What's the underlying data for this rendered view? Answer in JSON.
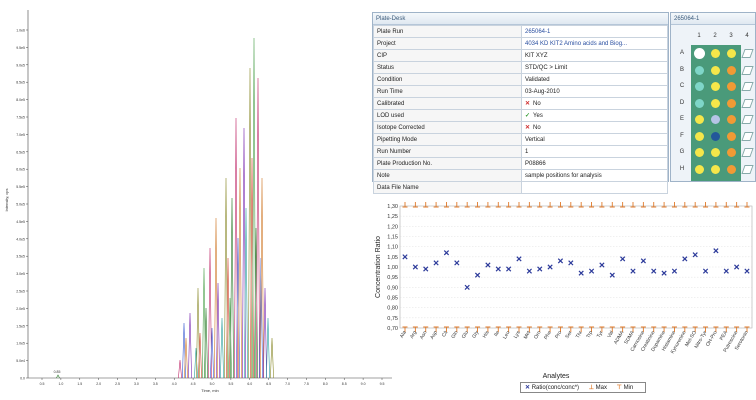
{
  "chromatogram": {
    "xlabel": "Time, min",
    "ylabel": "Intensity, cps",
    "yticks": [
      "1.0e6",
      "9.5e5",
      "9.0e5",
      "8.5e5",
      "8.0e5",
      "7.5e5",
      "7.0e5",
      "6.5e5",
      "6.0e5",
      "5.5e5",
      "5.0e5",
      "4.5e5",
      "4.0e5",
      "3.5e5",
      "3.0e5",
      "2.5e5",
      "2.0e5",
      "1.5e5",
      "1.0e5",
      "5.0e4",
      "0.0"
    ],
    "xticks": [
      "0.5",
      "1.0",
      "1.5",
      "2.0",
      "2.5",
      "3.0",
      "3.5",
      "4.0",
      "4.5",
      "5.0",
      "5.5",
      "6.0",
      "6.5",
      "7.0",
      "7.5",
      "8.0",
      "8.5",
      "9.0",
      "9.5"
    ],
    "peak_label": "0.85"
  },
  "plate_desk": {
    "title": "Plate-Desk",
    "rows": [
      {
        "key": "Plate Run",
        "value": "265064-1",
        "link": true
      },
      {
        "key": "Project",
        "value": "4034 KD KIT2 Amino acids and Biog...",
        "link": true
      },
      {
        "key": "CIP",
        "value": "KIT XYZ"
      },
      {
        "key": "Status",
        "value": "STD/QC > Limit"
      },
      {
        "key": "Condition",
        "value": "Validated"
      },
      {
        "key": "Run Time",
        "value": "03-Aug-2010"
      },
      {
        "key": "Calibrated",
        "value": "No",
        "mark": "x"
      },
      {
        "key": "LOD used",
        "value": "Yes",
        "mark": "ok"
      },
      {
        "key": "Isotope Corrected",
        "value": "No",
        "mark": "x"
      },
      {
        "key": "Pipetting Mode",
        "value": "Vertical"
      },
      {
        "key": "Run Number",
        "value": "1"
      },
      {
        "key": "Plate Production No.",
        "value": "P08866"
      },
      {
        "key": "Note",
        "value": "sample positions for analysis"
      },
      {
        "key": "Data File Name",
        "value": ""
      }
    ]
  },
  "plate_map": {
    "title": "265064-1",
    "columns": [
      "1",
      "2",
      "3",
      "4"
    ],
    "rows": [
      "A",
      "B",
      "C",
      "D",
      "E",
      "F",
      "G",
      "H"
    ],
    "wells": [
      [
        "#ffffff",
        "#f5e64a",
        "#f5e64a"
      ],
      [
        "#7fd6c8",
        "#f5e64a",
        "#f09a35"
      ],
      [
        "#7fd6c8",
        "#f5e64a",
        "#f09a35"
      ],
      [
        "#7fd6c8",
        "#f5e64a",
        "#f09a35"
      ],
      [
        "#f5e64a",
        "#b6c4e6",
        "#f09a35"
      ],
      [
        "#f5e64a",
        "#23579a",
        "#f09a35"
      ],
      [
        "#f5e64a",
        "#f5e64a",
        "#f09a35"
      ],
      [
        "#f5e64a",
        "#f5e64a",
        "#f09a35"
      ]
    ]
  },
  "chart_data": {
    "type": "scatter",
    "ylabel": "Concentration Ratio",
    "xlabel": "Analytes",
    "ylim": [
      0.7,
      1.3
    ],
    "yticks": [
      "1,30",
      "1,25",
      "1,20",
      "1,15",
      "1,10",
      "1,05",
      "1,00",
      "0,95",
      "0,90",
      "0,85",
      "0,80",
      "0,75",
      "0,70"
    ],
    "categories": [
      "Ala",
      "Arg",
      "Asn",
      "Asp",
      "Cit",
      "Gln",
      "Glu",
      "Gly",
      "His",
      "Ile",
      "Leu",
      "Lys",
      "Met",
      "Orn",
      "Phe",
      "Pro",
      "Ser",
      "Thr",
      "Trp",
      "Tyr",
      "Val",
      "ADMA",
      "SDMA",
      "Carnosine",
      "Creatinine",
      "Dopamine",
      "Histamine",
      "Kynurenine",
      "Met-SO",
      "Nitro-Tyr",
      "OH-Pro",
      "PEA",
      "Putrescine",
      "Serotonin"
    ],
    "series": [
      {
        "name": "Ratio(conc/conc*)",
        "values": [
          1.05,
          1.0,
          0.99,
          1.02,
          1.07,
          1.02,
          0.9,
          0.96,
          1.01,
          0.99,
          0.99,
          1.04,
          0.98,
          0.99,
          1.0,
          1.03,
          1.02,
          0.97,
          0.98,
          1.01,
          0.96,
          1.04,
          0.98,
          1.03,
          0.98,
          0.97,
          0.98,
          1.04,
          1.06,
          0.98,
          1.08,
          0.98,
          1.0,
          0.98
        ]
      },
      {
        "name": "Max",
        "values": [
          1.3,
          1.3,
          1.3,
          1.3,
          1.3,
          1.3,
          1.3,
          1.3,
          1.3,
          1.3,
          1.3,
          1.3,
          1.3,
          1.3,
          1.3,
          1.3,
          1.3,
          1.3,
          1.3,
          1.3,
          1.3,
          1.3,
          1.3,
          1.3,
          1.3,
          1.3,
          1.3,
          1.3,
          1.3,
          1.3,
          1.3,
          1.3,
          1.3,
          1.3
        ]
      },
      {
        "name": "Min",
        "values": [
          0.7,
          0.7,
          0.7,
          0.7,
          0.7,
          0.7,
          0.7,
          0.7,
          0.7,
          0.7,
          0.7,
          0.7,
          0.7,
          0.7,
          0.7,
          0.7,
          0.7,
          0.7,
          0.7,
          0.7,
          0.7,
          0.7,
          0.7,
          0.7,
          0.7,
          0.7,
          0.7,
          0.7,
          0.7,
          0.7,
          0.7,
          0.7,
          0.7,
          0.7
        ]
      }
    ],
    "legend": [
      "Ratio(conc/conc*)",
      "Max",
      "Min"
    ],
    "colors": {
      "ratio": "#2c3a9a",
      "limit": "#e07a2a"
    }
  }
}
